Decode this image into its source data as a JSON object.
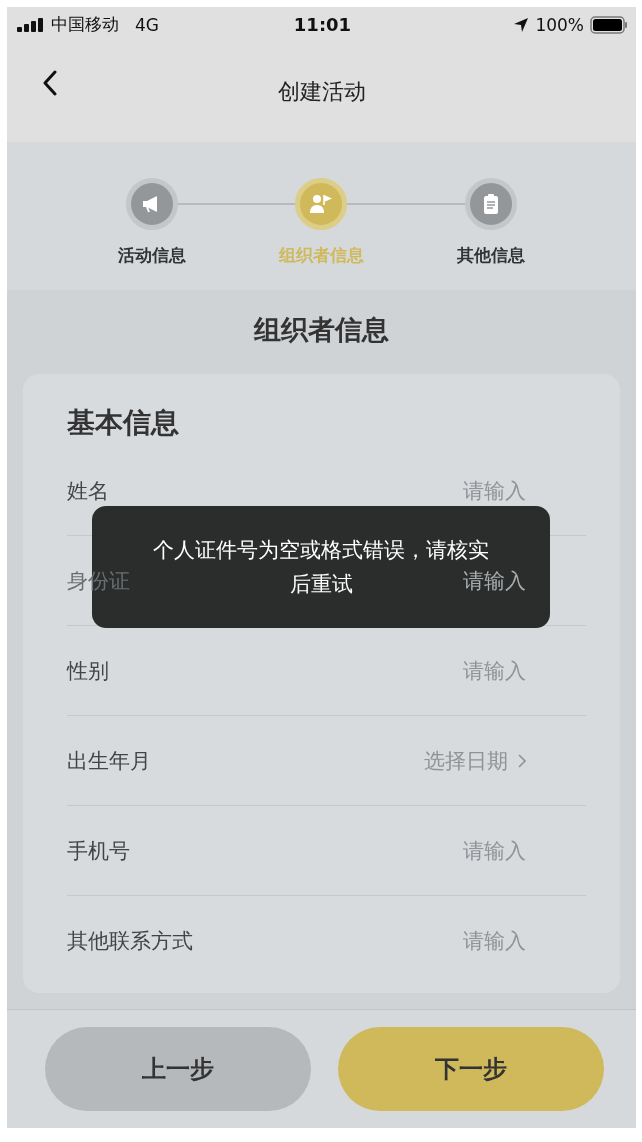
{
  "status_bar": {
    "carrier": "中国移动",
    "network": "4G",
    "time": "11:01",
    "battery": "100%"
  },
  "nav": {
    "title": "创建活动"
  },
  "steps": [
    {
      "label": "活动信息",
      "kind": "megaphone",
      "selected": false
    },
    {
      "label": "组织者信息",
      "kind": "person-flag",
      "selected": true
    },
    {
      "label": "其他信息",
      "kind": "clipboard",
      "selected": false
    }
  ],
  "section_title": "组织者信息",
  "card": {
    "title": "基本信息",
    "fields": [
      {
        "label": "姓名",
        "kind": "input",
        "placeholder": "请输入"
      },
      {
        "label": "身份证",
        "kind": "input",
        "placeholder": "请输入"
      },
      {
        "label": "性别",
        "kind": "input",
        "placeholder": "请输入"
      },
      {
        "label": "出生年月",
        "kind": "date",
        "placeholder": "选择日期"
      },
      {
        "label": "手机号",
        "kind": "input",
        "placeholder": "请输入"
      },
      {
        "label": "其他联系方式",
        "kind": "input",
        "placeholder": "请输入"
      }
    ]
  },
  "toast": "个人证件号为空或格式错误，请核实后重试",
  "buttons": {
    "prev": "上一步",
    "next": "下一步"
  }
}
